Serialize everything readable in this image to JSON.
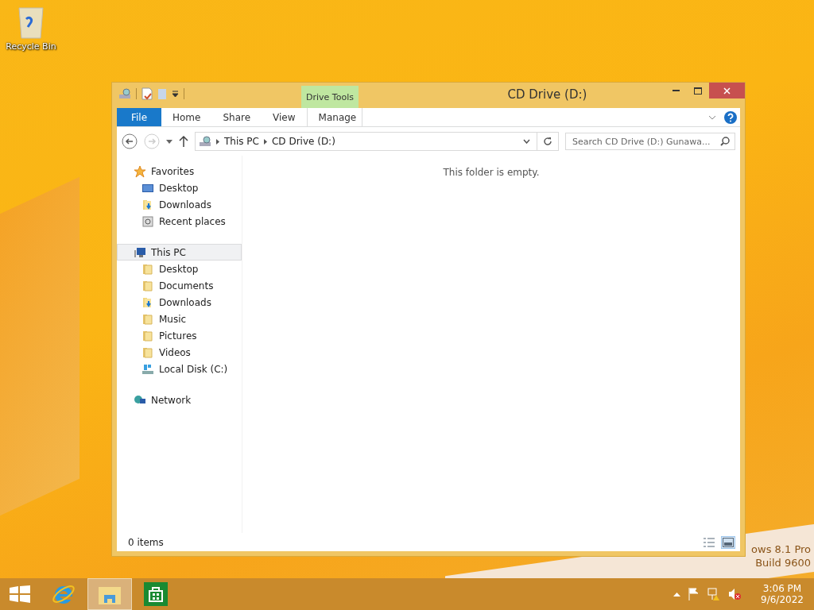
{
  "desktop": {
    "icons": [
      {
        "label": "Recycle Bin"
      }
    ],
    "watermark": [
      "ows 8.1 Pro",
      "Build 9600"
    ]
  },
  "window": {
    "title": "CD Drive (D:)",
    "context_group": "Drive Tools",
    "ribbon_tabs": [
      {
        "label": "File",
        "kind": "file",
        "selected": false
      },
      {
        "label": "Home",
        "kind": "tab",
        "selected": false
      },
      {
        "label": "Share",
        "kind": "tab",
        "selected": false
      },
      {
        "label": "View",
        "kind": "tab",
        "selected": false
      },
      {
        "label": "Manage",
        "kind": "context",
        "selected": false
      }
    ],
    "address": {
      "segments": [
        "This PC",
        "CD Drive (D:)"
      ]
    },
    "search": {
      "placeholder": "Search CD Drive (D:) Gunawa..."
    },
    "nav": [
      {
        "label": "Favorites",
        "kind": "star",
        "selected": false,
        "children": [
          {
            "label": "Desktop",
            "kind": "desktop",
            "selected": false
          },
          {
            "label": "Downloads",
            "kind": "download",
            "selected": false
          },
          {
            "label": "Recent places",
            "kind": "recent",
            "selected": false
          }
        ]
      },
      {
        "label": "This PC",
        "kind": "pc",
        "selected": true,
        "children": [
          {
            "label": "Desktop",
            "kind": "folder",
            "selected": false
          },
          {
            "label": "Documents",
            "kind": "folder",
            "selected": false
          },
          {
            "label": "Downloads",
            "kind": "download",
            "selected": false
          },
          {
            "label": "Music",
            "kind": "folder",
            "selected": false
          },
          {
            "label": "Pictures",
            "kind": "folder",
            "selected": false
          },
          {
            "label": "Videos",
            "kind": "folder",
            "selected": false
          },
          {
            "label": "Local Disk (C:)",
            "kind": "disk",
            "selected": false
          }
        ]
      },
      {
        "label": "Network",
        "kind": "network",
        "selected": false
      }
    ],
    "empty_message": "This folder is empty.",
    "status": {
      "count": "0 items",
      "views": [
        {
          "kind": "details",
          "selected": false
        },
        {
          "kind": "thumbs",
          "selected": true
        }
      ]
    }
  },
  "taskbar": {
    "apps": [
      {
        "kind": "ie",
        "selected": false
      },
      {
        "kind": "explorer",
        "selected": true
      },
      {
        "kind": "store",
        "selected": false
      }
    ],
    "clock": {
      "time": "3:06 PM",
      "date": "9/6/2022"
    }
  }
}
